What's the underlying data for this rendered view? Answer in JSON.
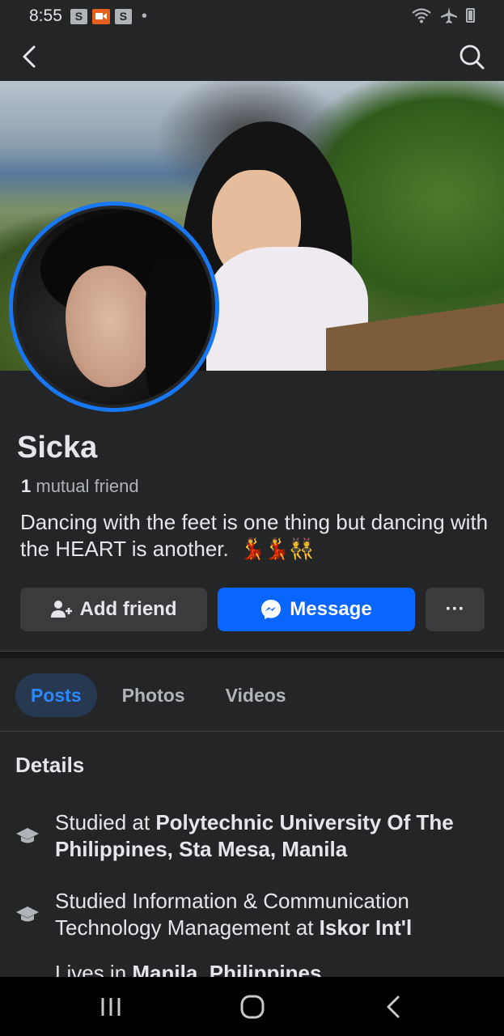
{
  "status_bar": {
    "time": "8:55",
    "notif_icon_1": "S",
    "notif_icon_3": "S",
    "icons": [
      "s-app-icon",
      "video-record-icon",
      "s-app-icon",
      "dot-icon",
      "wifi-icon",
      "airplane-icon",
      "battery-icon"
    ]
  },
  "nav": {
    "back_icon": "chevron-left-icon",
    "search_icon": "search-icon"
  },
  "profile": {
    "name": "Sicka",
    "mutual_count": "1",
    "mutual_label": "mutual friend",
    "bio": "Dancing with the feet is one thing but dancing with the HEART is another.",
    "bio_emoji": "💃💃👯"
  },
  "actions": {
    "add_friend": "Add friend",
    "message": "Message",
    "more": "···"
  },
  "tabs": [
    {
      "label": "Posts",
      "active": true
    },
    {
      "label": "Photos",
      "active": false
    },
    {
      "label": "Videos",
      "active": false
    }
  ],
  "details": {
    "title": "Details",
    "items": [
      {
        "prefix": "Studied at ",
        "bold": "Polytechnic University Of The Philippines, Sta Mesa, Manila",
        "suffix": ""
      },
      {
        "prefix": "Studied Information & Communication Technology Management at ",
        "bold": "Iskor Int'l",
        "suffix": ""
      },
      {
        "prefix": "Lives in ",
        "bold": "Manila, Philippines",
        "suffix": ""
      }
    ]
  },
  "system_nav": {
    "icons": [
      "recent-apps-icon",
      "home-icon",
      "back-icon"
    ]
  },
  "colors": {
    "background": "#242526",
    "primary": "#0866ff",
    "avatar_ring": "#1877f2",
    "active_tab_bg": "#263951",
    "active_tab_text": "#2d88ff"
  }
}
